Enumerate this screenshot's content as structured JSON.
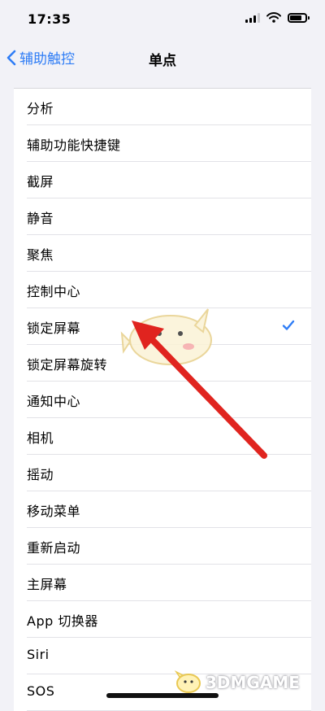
{
  "status": {
    "time": "17:35"
  },
  "nav": {
    "back_label": "辅助触控",
    "title": "单点"
  },
  "list": {
    "items": [
      {
        "label": "分析",
        "selected": false
      },
      {
        "label": "辅助功能快捷键",
        "selected": false
      },
      {
        "label": "截屏",
        "selected": false
      },
      {
        "label": "静音",
        "selected": false
      },
      {
        "label": "聚焦",
        "selected": false
      },
      {
        "label": "控制中心",
        "selected": false
      },
      {
        "label": "锁定屏幕",
        "selected": true
      },
      {
        "label": "锁定屏幕旋转",
        "selected": false
      },
      {
        "label": "通知中心",
        "selected": false
      },
      {
        "label": "相机",
        "selected": false
      },
      {
        "label": "摇动",
        "selected": false
      },
      {
        "label": "移动菜单",
        "selected": false
      },
      {
        "label": "重新启动",
        "selected": false
      },
      {
        "label": "主屏幕",
        "selected": false
      },
      {
        "label": "App 切换器",
        "selected": false
      },
      {
        "label": "Siri",
        "selected": false
      },
      {
        "label": "SOS",
        "selected": false
      }
    ]
  },
  "watermark": {
    "text": "3DMGAME"
  },
  "colors": {
    "accent": "#2f7df6",
    "arrow": "#e0241f",
    "background": "#f2f2f7"
  },
  "icons": {
    "back": "chevron-left-icon",
    "check": "checkmark-icon",
    "signal": "cellular-signal-icon",
    "wifi": "wifi-icon",
    "battery": "battery-icon",
    "mascot": "mascot-sticker"
  }
}
